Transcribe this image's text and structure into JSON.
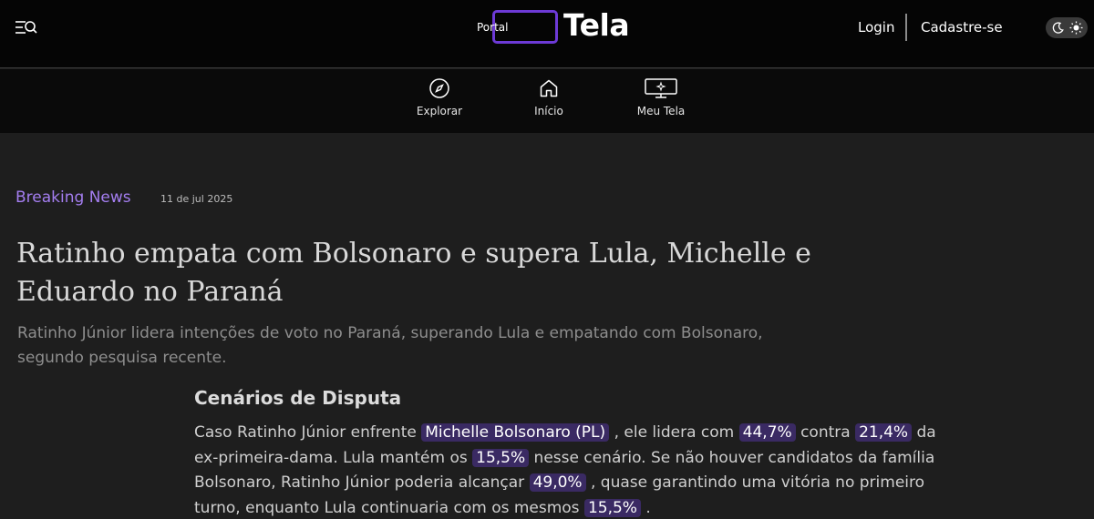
{
  "header": {
    "logo_small": "Portal",
    "logo_main": "Tela",
    "login_label": "Login",
    "signup_label": "Cadastre-se"
  },
  "nav": [
    {
      "label": "Explorar",
      "icon": "compass-icon"
    },
    {
      "label": "Início",
      "icon": "home-icon"
    },
    {
      "label": "Meu Tela",
      "icon": "monitor-icon"
    }
  ],
  "article": {
    "category": "Breaking News",
    "date": "11 de jul 2025",
    "headline": "Ratinho empata com Bolsonaro e supera Lula, Michelle e Eduardo no Paraná",
    "subtitle": "Ratinho Júnior lidera intenções de voto no Paraná, superando Lula e empatando com Bolsonaro, segundo pesquisa recente.",
    "section_title": "Cenários de Disputa",
    "paragraph": [
      {
        "text": "Caso Ratinho Júnior enfrente ",
        "hl": false
      },
      {
        "text": "Michelle Bolsonaro (PL)",
        "hl": true
      },
      {
        "text": " , ele lidera com ",
        "hl": false
      },
      {
        "text": "44,7%",
        "hl": true
      },
      {
        "text": " contra ",
        "hl": false
      },
      {
        "text": "21,4%",
        "hl": true
      },
      {
        "text": " da ex-primeira-dama. Lula mantém os ",
        "hl": false
      },
      {
        "text": "15,5%",
        "hl": true
      },
      {
        "text": " nesse cenário. Se não houver candidatos da família Bolsonaro, Ratinho Júnior poderia alcançar ",
        "hl": false
      },
      {
        "text": "49,0%",
        "hl": true
      },
      {
        "text": " , quase garantindo uma vitória no primeiro turno, enquanto Lula continuaria com os mesmos ",
        "hl": false
      },
      {
        "text": "15,5%",
        "hl": true
      },
      {
        "text": " .",
        "hl": false
      }
    ]
  },
  "colors": {
    "accent": "#a47ef0",
    "highlight_bg": "#3a2a63",
    "logo_border": "#6d3ad6"
  }
}
